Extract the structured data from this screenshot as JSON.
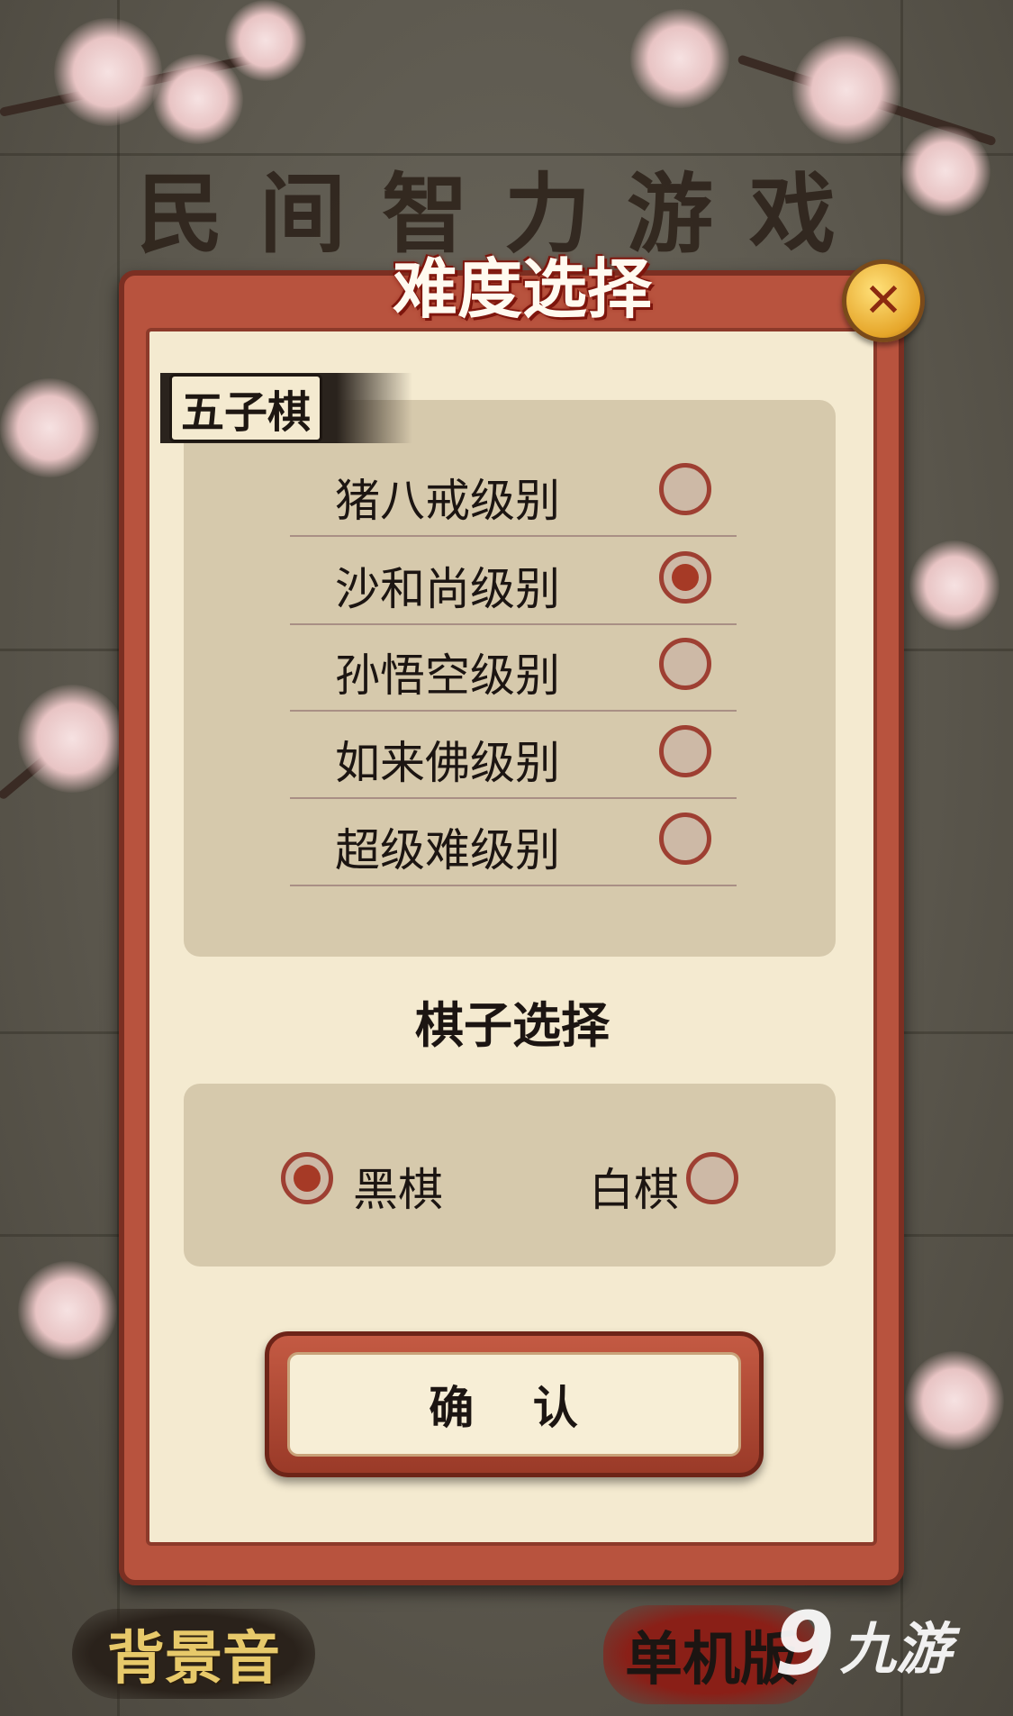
{
  "background": {
    "game_title": "民间智力游戏"
  },
  "dialog": {
    "header": "难度选择",
    "game_badge": "五子棋",
    "difficulty_levels": [
      {
        "label": "猪八戒级别",
        "selected": false
      },
      {
        "label": "沙和尚级别",
        "selected": true
      },
      {
        "label": "孙悟空级别",
        "selected": false
      },
      {
        "label": "如来佛级别",
        "selected": false
      },
      {
        "label": "超级难级别",
        "selected": false
      }
    ],
    "piece_section_title": "棋子选择",
    "pieces": [
      {
        "label": "黑棋",
        "selected": true
      },
      {
        "label": "白棋",
        "selected": false
      }
    ],
    "confirm_label": "确 认",
    "close_symbol": "✕"
  },
  "bottom_bar": {
    "music_label": "背景音",
    "single_player_label": "单机版"
  },
  "watermark": {
    "mark": "9",
    "text": "九游"
  },
  "colors": {
    "frame": "#b8533e",
    "panel": "#f4ead0",
    "option_box": "#d6c9ac",
    "radio_selected": "#a63a26"
  }
}
